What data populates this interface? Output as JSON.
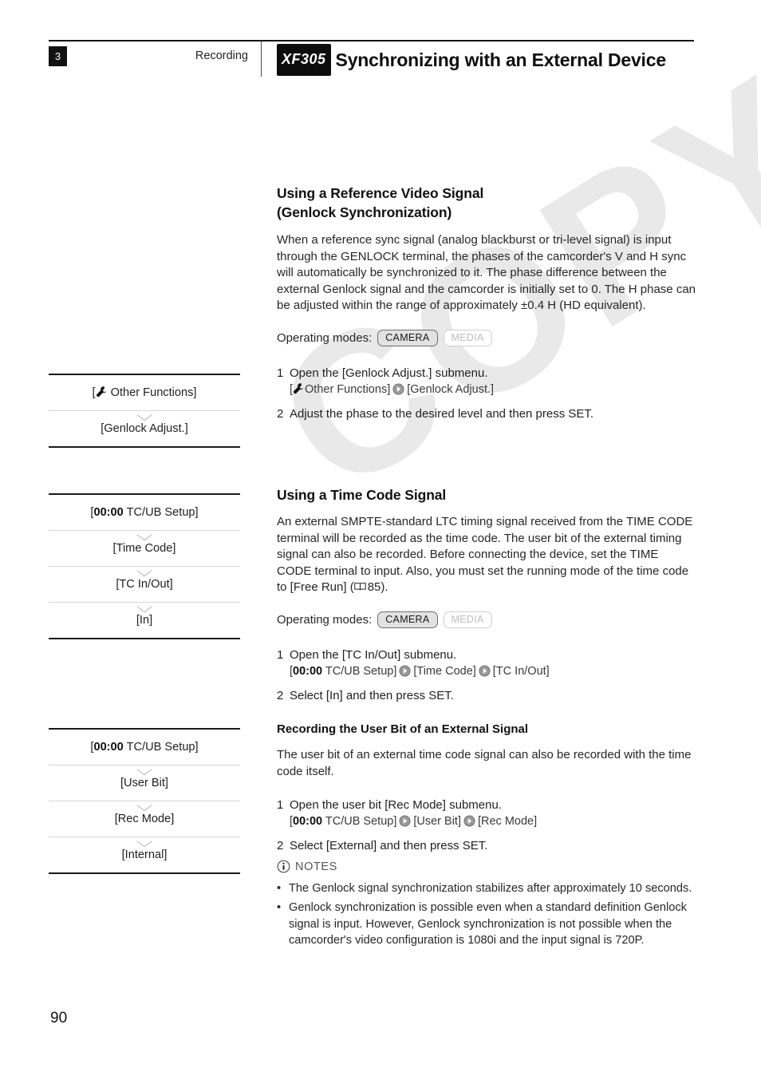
{
  "header": {
    "chapter_number": "3",
    "section": "Recording",
    "model_tag": "XF305",
    "title": "Synchronizing with an External Device"
  },
  "page_number": "90",
  "watermark": "COPY",
  "sections": {
    "genlock": {
      "heading_line1": "Using a Reference Video Signal",
      "heading_line2": "(Genlock Synchronization)",
      "body": "When a reference sync signal (analog blackburst or tri-level signal) is input through the GENLOCK terminal, the phases of the camcorder's V and H sync will automatically be synchronized to it. The phase difference between the external Genlock signal and the camcorder is initially set to 0. The H phase can be adjusted within the range of approximately ±0.4 H (HD equivalent).",
      "operating_modes_label": "Operating modes:",
      "mode_camera": "CAMERA",
      "mode_media": "MEDIA",
      "step1_num": "1",
      "step1_text": "Open the [Genlock Adjust.] submenu.",
      "step1_path_a": "Other Functions]",
      "step1_path_b": "[Genlock Adjust.]",
      "step2_num": "2",
      "step2_text": "Adjust the phase to the desired level and then press SET."
    },
    "timecode": {
      "heading": "Using a Time Code Signal",
      "body_part1": "An external SMPTE-standard LTC timing signal received from the TIME CODE terminal will be recorded as the time code. The user bit of the external timing signal can also be recorded. Before connecting the device, set the TIME CODE terminal to input. Also, you must set the running mode of the time code to [Free Run] (",
      "body_ref_page": "85",
      "body_part2": ").",
      "operating_modes_label": "Operating modes:",
      "mode_camera": "CAMERA",
      "mode_media": "MEDIA",
      "step1_num": "1",
      "step1_text": "Open the [TC In/Out] submenu.",
      "step1_path_clock": "00:00",
      "step1_path_a": "TC/UB Setup]",
      "step1_path_b": "[Time Code]",
      "step1_path_c": "[TC In/Out]",
      "step2_num": "2",
      "step2_text": "Select [In] and then press SET."
    },
    "userbit": {
      "heading": "Recording the User Bit of an External Signal",
      "body": "The user bit of an external time code signal can also be recorded with the time code itself.",
      "step1_num": "1",
      "step1_text": "Open the user bit [Rec Mode] submenu.",
      "step1_path_clock": "00:00",
      "step1_path_a": "TC/UB Setup]",
      "step1_path_b": "[User Bit]",
      "step1_path_c": "[Rec Mode]",
      "step2_num": "2",
      "step2_text": "Select [External] and then press SET."
    },
    "notes": {
      "label": "NOTES",
      "items": [
        "The Genlock signal synchronization stabilizes after approximately 10 seconds.",
        "Genlock synchronization is possible even when a standard definition Genlock signal is input. However, Genlock synchronization is not possible when the camcorder's video configuration is 1080i and the input signal is 720P."
      ]
    }
  },
  "menu_paths": [
    {
      "items": [
        {
          "prefix": "[",
          "icon": "wrench-icon",
          "label": "Other Functions]"
        },
        {
          "prefix": "",
          "icon": "",
          "label": "[Genlock Adjust.]"
        }
      ]
    },
    {
      "items": [
        {
          "prefix": "[",
          "icon": "timecode-icon",
          "clock": "00:00",
          "label": "TC/UB Setup]"
        },
        {
          "prefix": "",
          "icon": "",
          "label": "[Time Code]"
        },
        {
          "prefix": "",
          "icon": "",
          "label": "[TC In/Out]"
        },
        {
          "prefix": "",
          "icon": "",
          "label": "[In]"
        }
      ]
    },
    {
      "items": [
        {
          "prefix": "[",
          "icon": "timecode-icon",
          "clock": "00:00",
          "label": "TC/UB Setup]"
        },
        {
          "prefix": "",
          "icon": "",
          "label": "[User Bit]"
        },
        {
          "prefix": "",
          "icon": "",
          "label": "[Rec Mode]"
        },
        {
          "prefix": "",
          "icon": "",
          "label": "[Internal]"
        }
      ]
    }
  ]
}
